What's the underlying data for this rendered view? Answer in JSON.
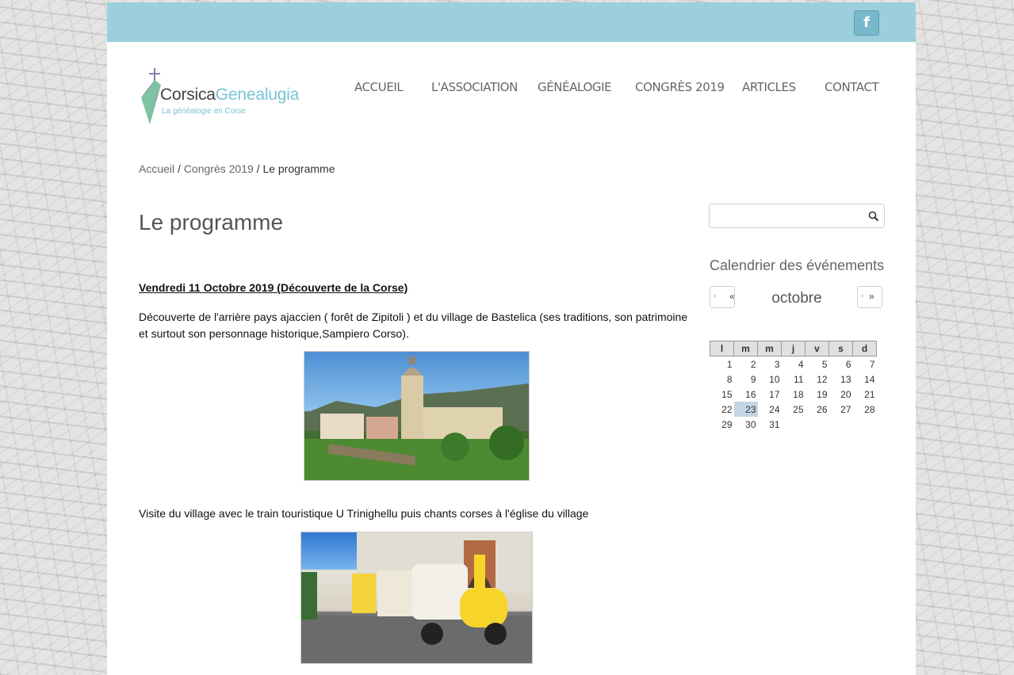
{
  "header": {
    "social_icon_glyph": "f",
    "social_icon": "facebook-icon",
    "topbar_color": "#9ccfdd"
  },
  "logo": {
    "name_part1": "Corsica",
    "name_part2": "Genealugia",
    "tagline": "La généalogie en Corse",
    "accent": "#78c2d4"
  },
  "nav": {
    "items": [
      {
        "label": "ACCUEIL"
      },
      {
        "label": "L'ASSOCIATION"
      },
      {
        "label": "GÉNÉALOGIE"
      },
      {
        "label": "CONGRÈS 2019"
      },
      {
        "label": "ARTICLES"
      },
      {
        "label": "CONTACT"
      }
    ]
  },
  "breadcrumb": {
    "home": "Accueil",
    "sep": "/",
    "parent": "Congrès 2019",
    "current": "Le programme"
  },
  "content": {
    "title": "Le programme",
    "day_heading": "Vendredi 11 Octobre 2019 (Découverte de la Corse)",
    "paragraph1": "Découverte de l'arrière pays ajaccien ( forêt de Zipitoli ) et du village de Bastelica (ses traditions, son patrimoine et surtout son personnage historique,Sampiero Corso).",
    "paragraph2": "Visite du village avec le train touristique U Trinighellu puis chants corses à l'église du village"
  },
  "sidebar": {
    "search_value": "",
    "widget_title": "Calendrier des événements",
    "calendar": {
      "prev_label": "«",
      "next_label": "»",
      "month": "octobre",
      "weekdays": [
        "l",
        "m",
        "m",
        "j",
        "v",
        "s",
        "d"
      ],
      "weeks": [
        [
          "1",
          "2",
          "3",
          "4",
          "5",
          "6",
          "7"
        ],
        [
          "8",
          "9",
          "10",
          "11",
          "12",
          "13",
          "14"
        ],
        [
          "15",
          "16",
          "17",
          "18",
          "19",
          "20",
          "21"
        ],
        [
          "22",
          "23",
          "24",
          "25",
          "26",
          "27",
          "28"
        ],
        [
          "29",
          "30",
          "31",
          "",
          "",
          "",
          ""
        ]
      ],
      "highlighted_day": "23",
      "highlight_color": "#c4d6e4"
    }
  }
}
